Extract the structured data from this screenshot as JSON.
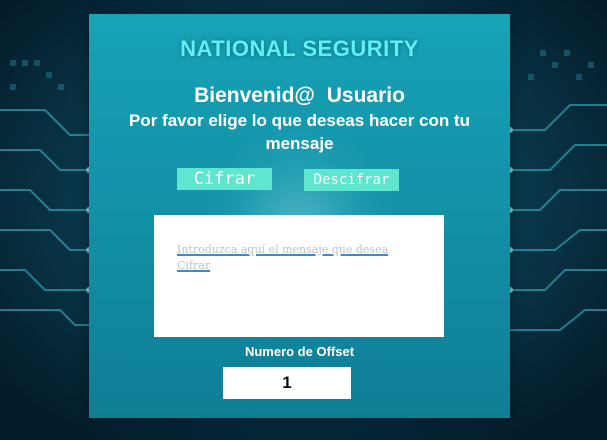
{
  "app": {
    "title": "NATIONAL SEGURITY"
  },
  "welcome": {
    "greeting": "Bienvenid@",
    "user": "Usuario",
    "prompt": "Por favor elige lo que deseas hacer con tu mensaje"
  },
  "actions": {
    "encrypt_label": "Cifrar",
    "decrypt_label": "Descifrar"
  },
  "message": {
    "placeholder": "Introduzca aquí el mensaje que desea Cifrar",
    "value": ""
  },
  "offset": {
    "label": "Numero de Offset",
    "value": "1"
  },
  "colors": {
    "panel": "#1392a8",
    "title": "#5ff0f5",
    "button": "#5fe6cf",
    "background": "#06283a",
    "circuit": "#2fb4c9"
  }
}
